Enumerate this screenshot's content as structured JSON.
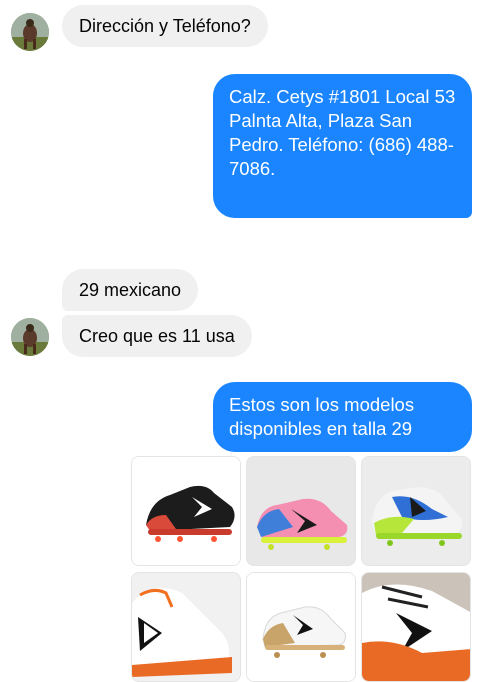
{
  "messages": {
    "m1": "Dirección y Teléfono?",
    "m2": "Calz. Cetys #1801 Local 53 Palnta Alta, Plaza San Pedro. Teléfono: (686) 488-7086.",
    "m3": "29 mexicano",
    "m4": "Creo que es 11 usa",
    "m5": "Estos son los modelos disponibles en talla 29"
  },
  "colors": {
    "outgoing": "#1a85ff",
    "incoming": "#f0f0f0"
  },
  "gallery": [
    {
      "icon": "black-red-boot-photo"
    },
    {
      "icon": "pink-blue-yellow-boot-photo"
    },
    {
      "icon": "green-blue-white-boot-photo"
    },
    {
      "icon": "white-orange-boot-photo"
    },
    {
      "icon": "white-gold-boot-photo"
    },
    {
      "icon": "white-orange-black-boot-photo"
    }
  ]
}
